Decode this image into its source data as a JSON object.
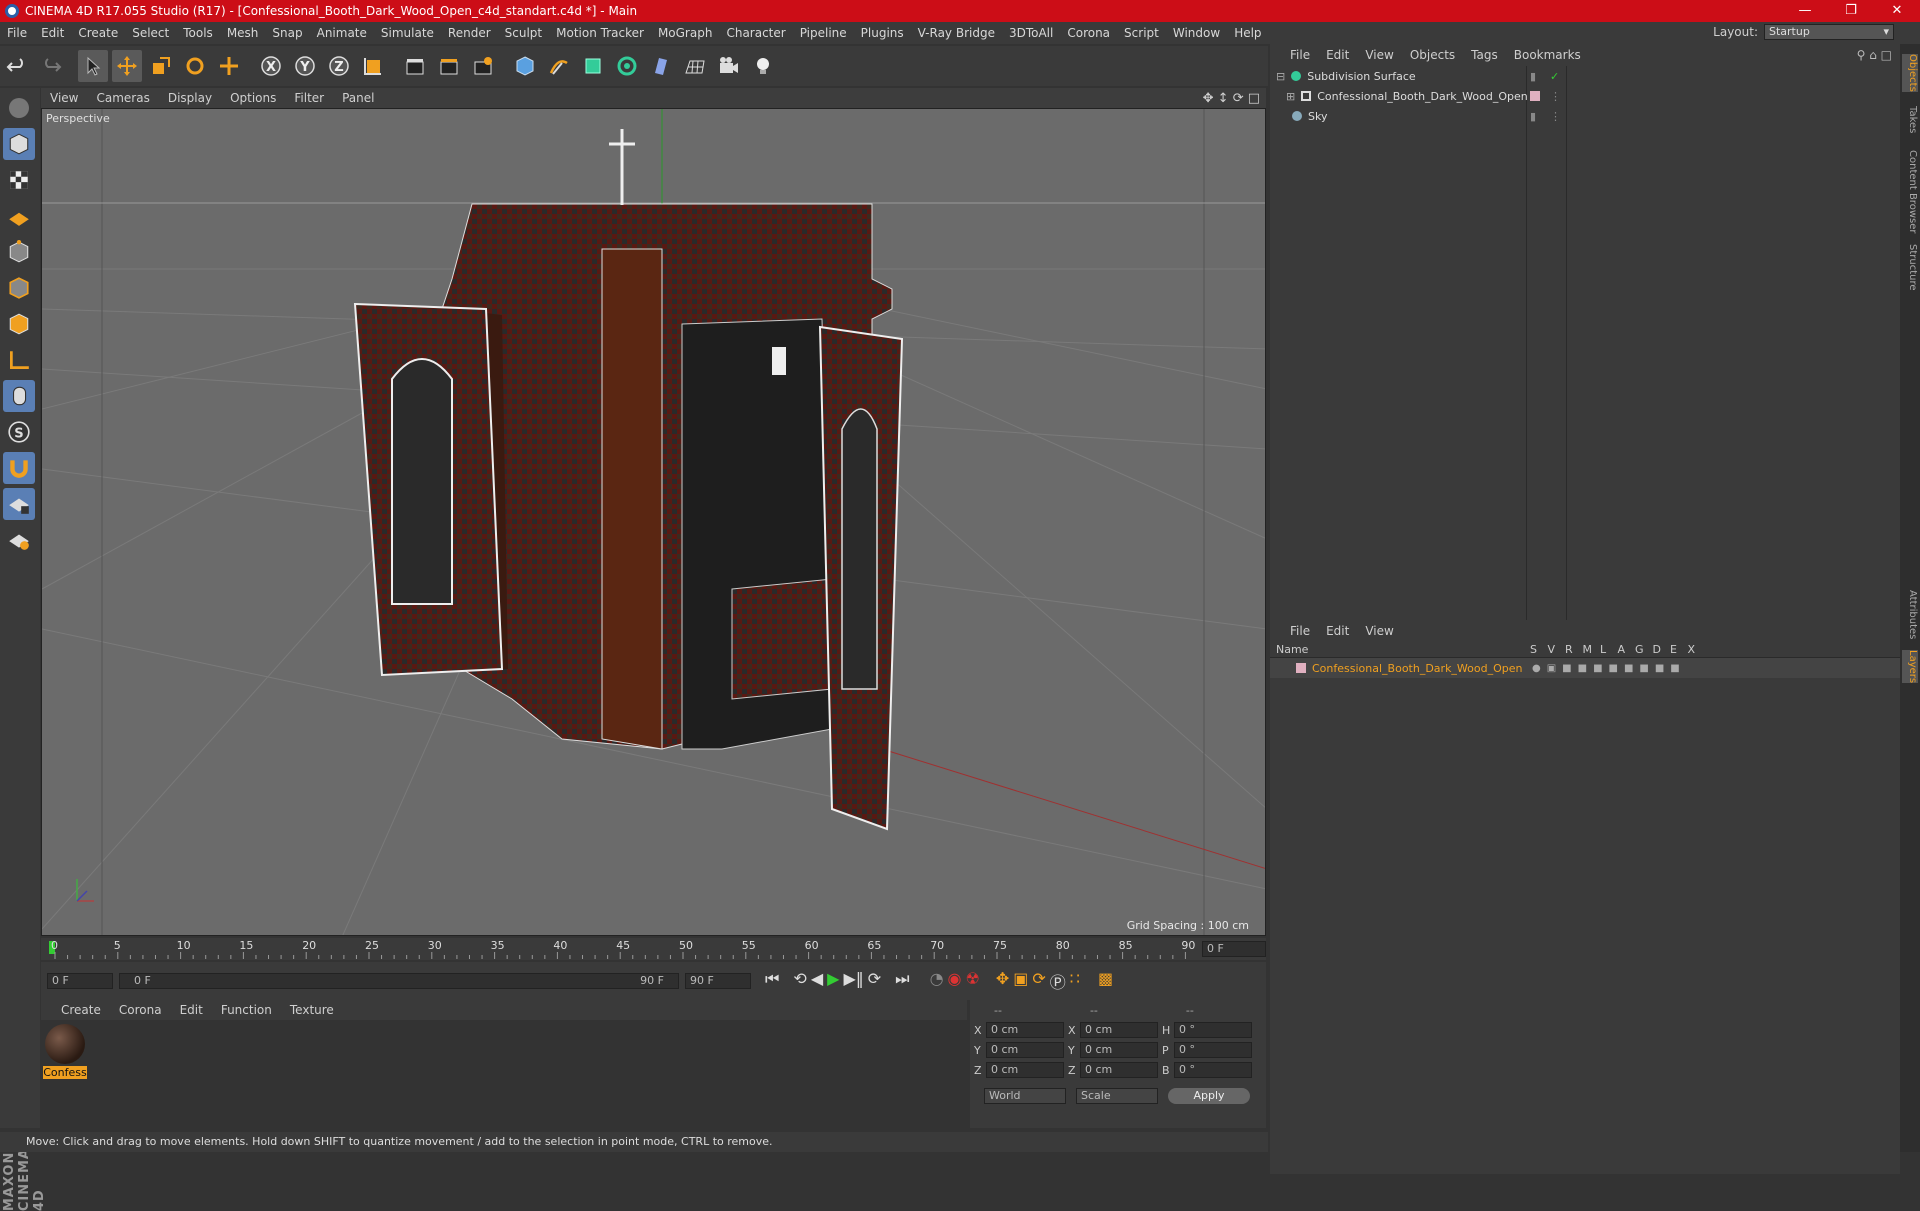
{
  "window": {
    "title": "CINEMA 4D R17.055 Studio (R17) - [Confessional_Booth_Dark_Wood_Open_c4d_standart.c4d *] - Main"
  },
  "menu": [
    "File",
    "Edit",
    "Create",
    "Select",
    "Tools",
    "Mesh",
    "Snap",
    "Animate",
    "Simulate",
    "Render",
    "Sculpt",
    "Motion Tracker",
    "MoGraph",
    "Character",
    "Pipeline",
    "Plugins",
    "V-Ray Bridge",
    "3DToAll",
    "Corona",
    "Script",
    "Window",
    "Help"
  ],
  "layout": {
    "label": "Layout:",
    "value": "Startup"
  },
  "viewport": {
    "menu": [
      "View",
      "Cameras",
      "Display",
      "Options",
      "Filter",
      "Panel"
    ],
    "label": "Perspective",
    "grid_spacing": "Grid Spacing : 100 cm"
  },
  "timeline": {
    "ticks": [
      "0",
      "5",
      "10",
      "15",
      "20",
      "25",
      "30",
      "35",
      "40",
      "45",
      "50",
      "55",
      "60",
      "65",
      "70",
      "75",
      "80",
      "85",
      "90"
    ],
    "current_frame_right": "0 F",
    "start_field": "0 F",
    "range_start": "0 F",
    "range_end": "90 F",
    "end_field": "90 F"
  },
  "material_panel": {
    "menu": [
      "Create",
      "Corona",
      "Edit",
      "Function",
      "Texture"
    ],
    "material_name": "Confess"
  },
  "coords": {
    "header": [
      "--",
      "--",
      "--"
    ],
    "rows": [
      {
        "a": "X",
        "av": "0 cm",
        "b": "X",
        "bv": "0 cm",
        "c": "H",
        "cv": "0 °"
      },
      {
        "a": "Y",
        "av": "0 cm",
        "b": "Y",
        "bv": "0 cm",
        "c": "P",
        "cv": "0 °"
      },
      {
        "a": "Z",
        "av": "0 cm",
        "b": "Z",
        "bv": "0 cm",
        "c": "B",
        "cv": "0 °"
      }
    ],
    "world": "World",
    "scale": "Scale",
    "apply": "Apply"
  },
  "status": "Move: Click and drag to move elements. Hold down SHIFT to quantize movement / add to the selection in point mode, CTRL to remove.",
  "objects_panel": {
    "menu": [
      "File",
      "Edit",
      "View",
      "Objects",
      "Tags",
      "Bookmarks"
    ],
    "items": [
      {
        "name": "Subdivision Surface"
      },
      {
        "name": "Confessional_Booth_Dark_Wood_Open"
      },
      {
        "name": "Sky"
      }
    ]
  },
  "layers_panel": {
    "menu": [
      "File",
      "Edit",
      "View"
    ],
    "columns": [
      "Name",
      "S",
      "V",
      "R",
      "M",
      "L",
      "A",
      "G",
      "D",
      "E",
      "X"
    ],
    "item": "Confessional_Booth_Dark_Wood_Open"
  },
  "side_tabs": [
    "Objects",
    "Takes",
    "Content Browser",
    "Structure",
    "Attributes",
    "Layers"
  ],
  "brand": "MAXON CINEMA 4D",
  "colors": {
    "title_bar": "#cc0d17",
    "accent": "#f0a020",
    "panel": "#3a3a3a",
    "viewport": "#6b6b6b"
  }
}
